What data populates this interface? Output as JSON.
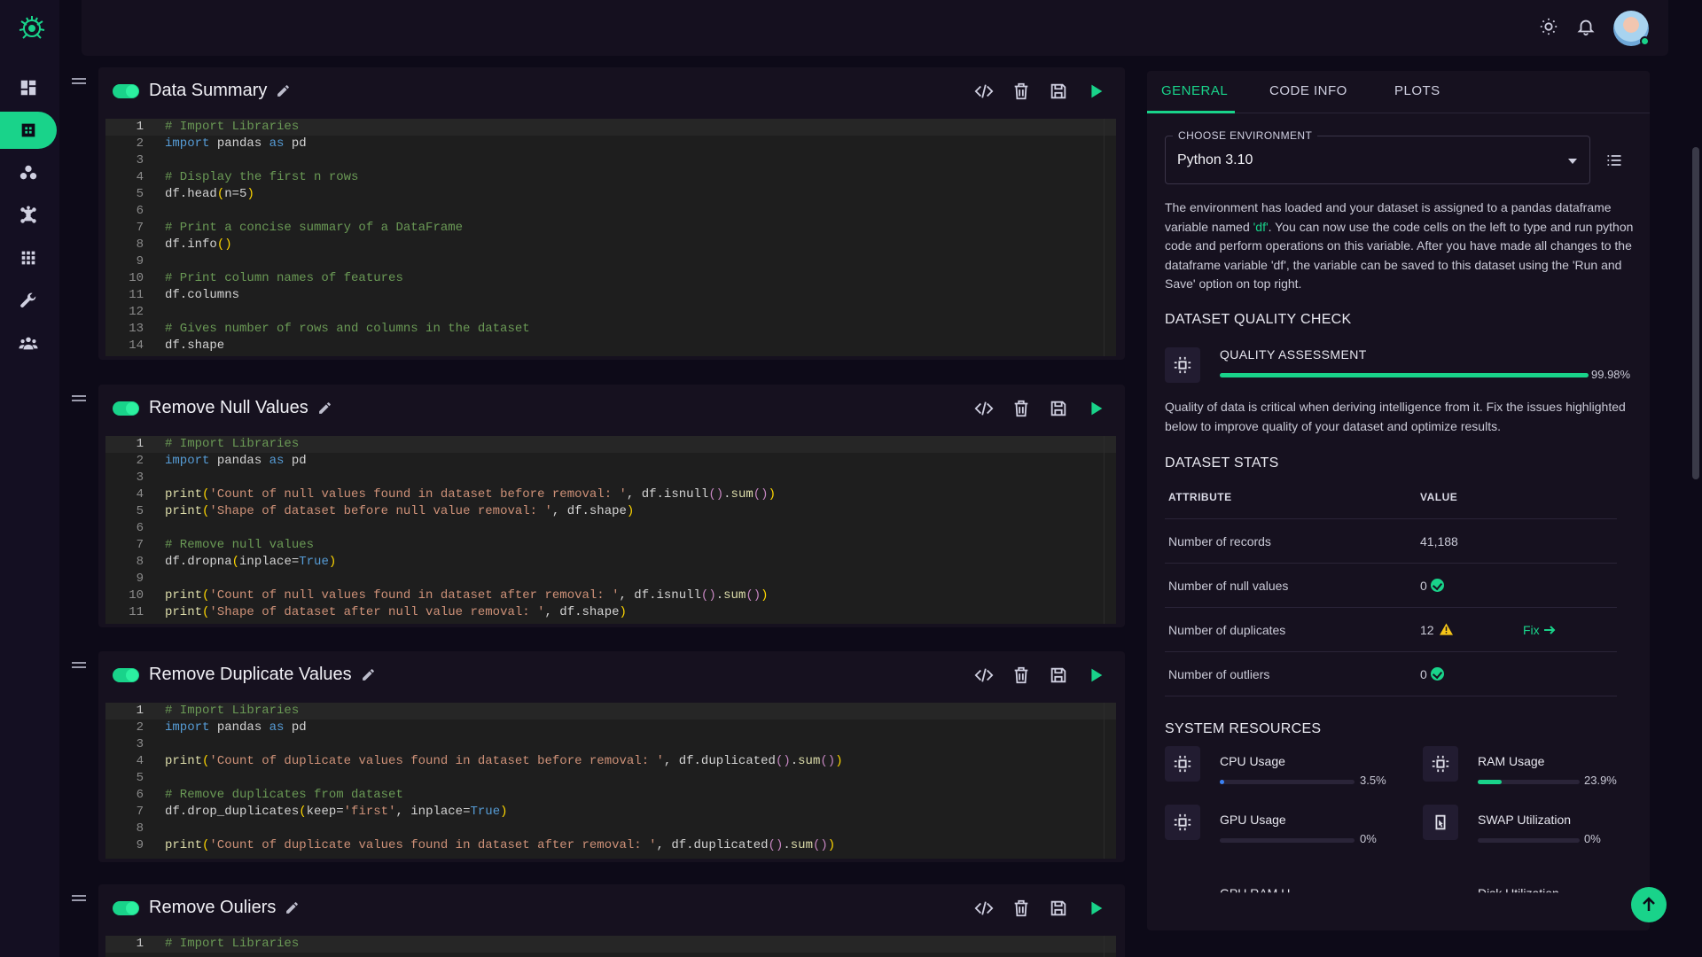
{
  "sidebar": {
    "items": [
      {
        "name": "dashboard",
        "active": false
      },
      {
        "name": "workspace",
        "active": true
      },
      {
        "name": "datasets",
        "active": false
      },
      {
        "name": "models",
        "active": false
      },
      {
        "name": "apps",
        "active": false
      },
      {
        "name": "tools",
        "active": false
      },
      {
        "name": "team",
        "active": false
      }
    ]
  },
  "cells": [
    {
      "title": "Data Summary",
      "lines": [
        [
          [
            "c",
            "# Import Libraries"
          ]
        ],
        [
          [
            "k",
            "import"
          ],
          [
            "t",
            " pandas "
          ],
          [
            "k",
            "as"
          ],
          [
            "t",
            " pd"
          ]
        ],
        [],
        [
          [
            "c",
            "# Display the first n rows"
          ]
        ],
        [
          [
            "t",
            "df.head"
          ],
          [
            "p",
            "("
          ],
          [
            "t",
            "n="
          ],
          [
            "t",
            "5"
          ],
          [
            "p",
            ")"
          ]
        ],
        [],
        [
          [
            "c",
            "# Print a concise summary of a DataFrame"
          ]
        ],
        [
          [
            "t",
            "df.info"
          ],
          [
            "p",
            "()"
          ]
        ],
        [],
        [
          [
            "c",
            "# Print column names of features"
          ]
        ],
        [
          [
            "t",
            "df.columns"
          ]
        ],
        [],
        [
          [
            "c",
            "# Gives number of rows and columns in the dataset"
          ]
        ],
        [
          [
            "t",
            "df.shape"
          ]
        ]
      ]
    },
    {
      "title": "Remove Null Values",
      "lines": [
        [
          [
            "c",
            "# Import Libraries"
          ]
        ],
        [
          [
            "k",
            "import"
          ],
          [
            "t",
            " pandas "
          ],
          [
            "k",
            "as"
          ],
          [
            "t",
            " pd"
          ]
        ],
        [],
        [
          [
            "f",
            "print"
          ],
          [
            "p",
            "("
          ],
          [
            "s",
            "'Count of null values found in dataset before removal: '"
          ],
          [
            "t",
            ", df.isnull"
          ],
          [
            "m",
            "()"
          ],
          [
            "t",
            "."
          ],
          [
            "f",
            "sum"
          ],
          [
            "m",
            "()"
          ],
          [
            "p",
            ")"
          ]
        ],
        [
          [
            "f",
            "print"
          ],
          [
            "p",
            "("
          ],
          [
            "s",
            "'Shape of dataset before null value removal: '"
          ],
          [
            "t",
            ", df.shape"
          ],
          [
            "p",
            ")"
          ]
        ],
        [],
        [
          [
            "c",
            "# Remove null values"
          ]
        ],
        [
          [
            "t",
            "df.dropna"
          ],
          [
            "p",
            "("
          ],
          [
            "t",
            "inplace="
          ],
          [
            "k",
            "True"
          ],
          [
            "p",
            ")"
          ]
        ],
        [],
        [
          [
            "f",
            "print"
          ],
          [
            "p",
            "("
          ],
          [
            "s",
            "'Count of null values found in dataset after removal: '"
          ],
          [
            "t",
            ", df.isnull"
          ],
          [
            "m",
            "()"
          ],
          [
            "t",
            "."
          ],
          [
            "f",
            "sum"
          ],
          [
            "m",
            "()"
          ],
          [
            "p",
            ")"
          ]
        ],
        [
          [
            "f",
            "print"
          ],
          [
            "p",
            "("
          ],
          [
            "s",
            "'Shape of dataset after null value removal: '"
          ],
          [
            "t",
            ", df.shape"
          ],
          [
            "p",
            ")"
          ]
        ]
      ]
    },
    {
      "title": "Remove Duplicate Values",
      "lines": [
        [
          [
            "c",
            "# Import Libraries"
          ]
        ],
        [
          [
            "k",
            "import"
          ],
          [
            "t",
            " pandas "
          ],
          [
            "k",
            "as"
          ],
          [
            "t",
            " pd"
          ]
        ],
        [],
        [
          [
            "f",
            "print"
          ],
          [
            "p",
            "("
          ],
          [
            "s",
            "'Count of duplicate values found in dataset before removal: '"
          ],
          [
            "t",
            ", df.duplicated"
          ],
          [
            "m",
            "()"
          ],
          [
            "t",
            "."
          ],
          [
            "f",
            "sum"
          ],
          [
            "m",
            "()"
          ],
          [
            "p",
            ")"
          ]
        ],
        [],
        [
          [
            "c",
            "# Remove duplicates from dataset"
          ]
        ],
        [
          [
            "t",
            "df.drop_duplicates"
          ],
          [
            "p",
            "("
          ],
          [
            "t",
            "keep="
          ],
          [
            "s",
            "'first'"
          ],
          [
            "t",
            ", inplace="
          ],
          [
            "k",
            "True"
          ],
          [
            "p",
            ")"
          ]
        ],
        [],
        [
          [
            "f",
            "print"
          ],
          [
            "p",
            "("
          ],
          [
            "s",
            "'Count of duplicate values found in dataset after removal: '"
          ],
          [
            "t",
            ", df.duplicated"
          ],
          [
            "m",
            "()"
          ],
          [
            "t",
            "."
          ],
          [
            "f",
            "sum"
          ],
          [
            "m",
            "()"
          ],
          [
            "p",
            ")"
          ]
        ]
      ]
    },
    {
      "title": "Remove Ouliers",
      "lines": [
        [
          [
            "c",
            "# Import Libraries"
          ]
        ]
      ]
    }
  ],
  "panel": {
    "tabs": [
      "GENERAL",
      "CODE INFO",
      "PLOTS"
    ],
    "env_label": "CHOOSE ENVIRONMENT",
    "env_value": "Python 3.10",
    "intro_pre": "The environment has loaded and your dataset is assigned to a pandas dataframe variable named ",
    "intro_var": "'df'",
    "intro_post": ". You can now use the code cells on the left to type and run python code and perform operations on this variable. After you have made all changes to the dataframe variable 'df', the variable can be saved to this dataset using the 'Run and Save' option on top right.",
    "quality_title": "DATASET QUALITY CHECK",
    "quality_label": "QUALITY ASSESSMENT",
    "quality_pct": "99.98%",
    "quality_value": 0.9998,
    "quality_note": "Quality of data is critical when deriving intelligence from it. Fix the issues highlighted below to improve quality of your dataset and optimize results.",
    "stats_title": "DATASET STATS",
    "stats_cols": [
      "ATTRIBUTE",
      "VALUE"
    ],
    "stats_rows": [
      {
        "attr": "Number of records",
        "value": "41,188"
      },
      {
        "attr": "Number of null values",
        "value": "0"
      },
      {
        "attr": "Number of duplicates",
        "value": "12",
        "fix": "Fix"
      },
      {
        "attr": "Number of outliers",
        "value": "0"
      }
    ],
    "resources_title": "SYSTEM RESOURCES",
    "resources": [
      {
        "label": "CPU Usage",
        "pct": "3.5%",
        "value": 0.035,
        "color": "#3b82f6"
      },
      {
        "label": "RAM Usage",
        "pct": "23.9%",
        "value": 0.239,
        "color": "#19d38a"
      },
      {
        "label": "GPU Usage",
        "pct": "0%",
        "value": 0,
        "color": "#3b82f6"
      },
      {
        "label": "SWAP Utilization",
        "pct": "0%",
        "value": 0,
        "color": "#3b82f6"
      }
    ],
    "resources_cut": [
      "GPU RAM U",
      "Disk Utilization"
    ]
  },
  "colors": {
    "accent": "#19d38a",
    "warn": "#f5c518"
  }
}
